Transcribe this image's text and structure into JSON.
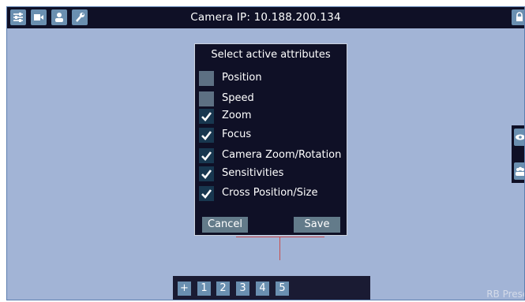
{
  "colors": {
    "background": "#a2b4d6",
    "bar": "#0f1026",
    "button": "#6a8fb0",
    "checkbox_off": "#5d7083",
    "checkbox_on": "#18374f",
    "dialog_button": "#637b8a",
    "cross": "#c84d4d"
  },
  "topbar": {
    "icons": [
      "sliders-icon",
      "video-camera-icon",
      "user-icon",
      "wrench-icon"
    ],
    "title": "Camera IP: 10.188.200.134",
    "lock_icon": "lock-icon"
  },
  "side_panel": {
    "icons": [
      "eye-icon",
      "group-icon"
    ]
  },
  "dialog": {
    "title": "Select active attributes",
    "attributes": [
      {
        "label": "Position",
        "checked": false
      },
      {
        "label": "Speed",
        "checked": false
      },
      {
        "label": "Zoom",
        "checked": true
      },
      {
        "label": "Focus",
        "checked": true
      },
      {
        "label": "Camera Zoom/Rotation",
        "checked": true
      },
      {
        "label": "Sensitivities",
        "checked": true
      },
      {
        "label": "Cross Position/Size",
        "checked": true
      }
    ],
    "cancel_label": "Cancel",
    "save_label": "Save"
  },
  "bottombar": {
    "add_label": "+",
    "presets": [
      "1",
      "2",
      "3",
      "4",
      "5"
    ]
  },
  "watermark": "RB Preset"
}
